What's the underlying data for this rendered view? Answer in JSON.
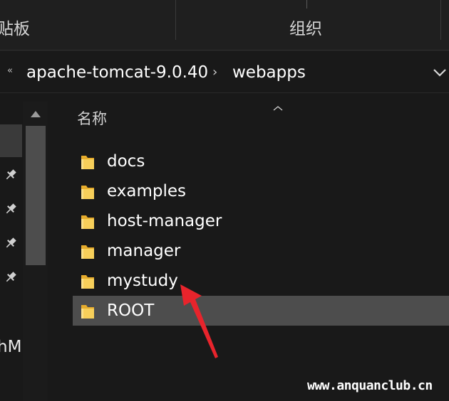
{
  "ribbon": {
    "groups": [
      {
        "label": "贴板"
      },
      {
        "label": "组织"
      }
    ]
  },
  "address_bar": {
    "overflow_icon": "double-chevron-left-icon",
    "crumbs": [
      "apache-tomcat-9.0.40",
      "webapps"
    ],
    "separator_icon": "chevron-right-icon",
    "dropdown_icon": "chevron-down-icon"
  },
  "navigation_pane": {
    "pinned_icon": "pin-icon",
    "partial_text": "hM"
  },
  "file_list": {
    "column_header": "名称",
    "items": [
      {
        "name": "docs",
        "icon": "folder-icon",
        "selected": false
      },
      {
        "name": "examples",
        "icon": "folder-icon",
        "selected": false
      },
      {
        "name": "host-manager",
        "icon": "folder-icon",
        "selected": false
      },
      {
        "name": "manager",
        "icon": "folder-icon",
        "selected": false
      },
      {
        "name": "mystudy",
        "icon": "folder-icon",
        "selected": false
      },
      {
        "name": "ROOT",
        "icon": "folder-icon",
        "selected": true
      }
    ]
  },
  "annotation": {
    "arrow_color": "#e8242c"
  },
  "watermark": {
    "text": "www.anquanclub.cn"
  },
  "colors": {
    "background": "#191919",
    "selection": "#4d4d4d",
    "folder": "#f4c64a"
  }
}
